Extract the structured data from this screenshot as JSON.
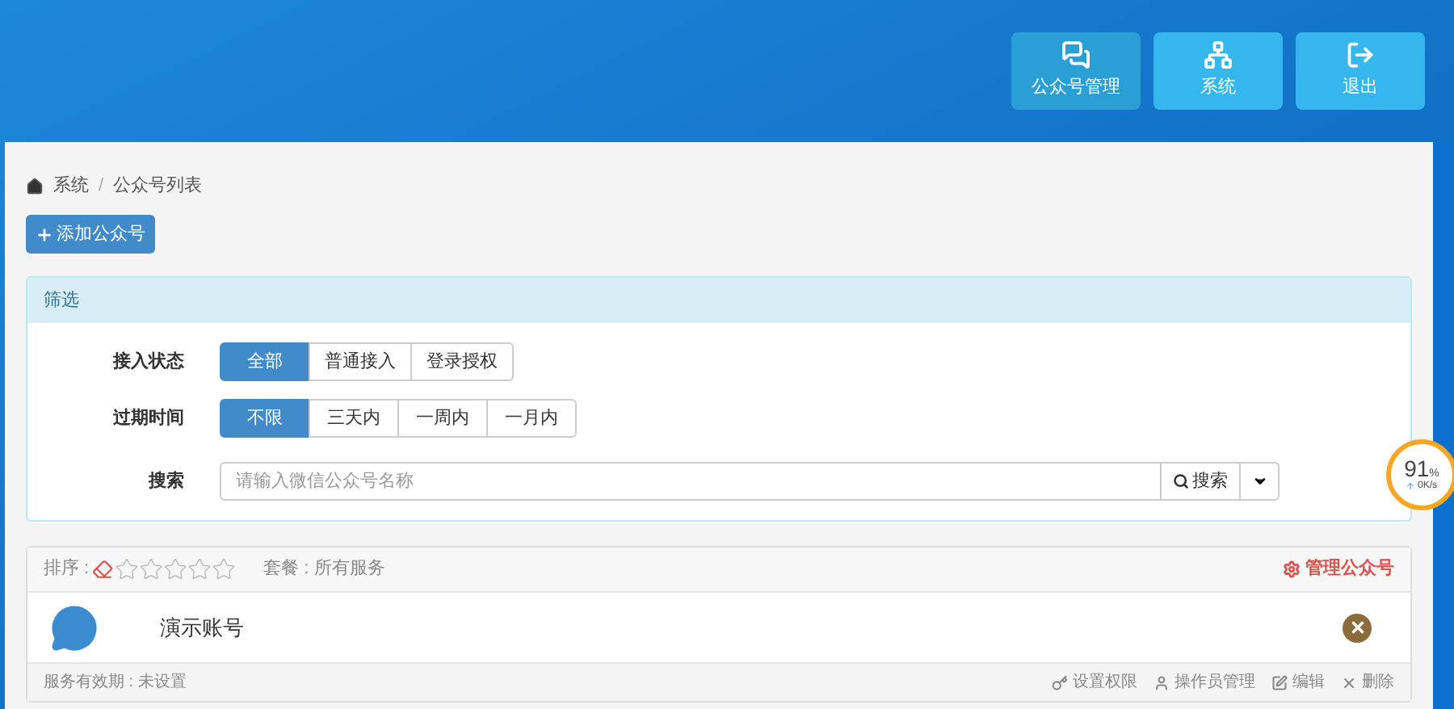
{
  "nav": [
    {
      "label": "公众号管理",
      "selected": true
    },
    {
      "label": "系统",
      "selected": false
    },
    {
      "label": "退出",
      "selected": false
    }
  ],
  "breadcrumb": {
    "items": [
      "系统",
      "公众号列表"
    ],
    "separator": "/"
  },
  "add_button": "添加公众号",
  "filter": {
    "title": "筛选",
    "groups": [
      {
        "label": "接入状态",
        "options": [
          {
            "label": "全部",
            "selected": true
          },
          {
            "label": "普通接入",
            "selected": false
          },
          {
            "label": "登录授权",
            "selected": false
          }
        ]
      },
      {
        "label": "过期时间",
        "options": [
          {
            "label": "不限",
            "selected": true
          },
          {
            "label": "三天内",
            "selected": false
          },
          {
            "label": "一周内",
            "selected": false
          },
          {
            "label": "一月内",
            "selected": false
          }
        ]
      }
    ],
    "search": {
      "label": "搜索",
      "placeholder": "请输入微信公众号名称",
      "button": "搜索"
    }
  },
  "account": {
    "sort_label": "排序 :",
    "stars": 0,
    "package": "套餐 : 所有服务",
    "manage": "管理公众号",
    "name": "演示账号",
    "validity": "服务有效期 : 未设置",
    "actions": [
      {
        "label": "设置权限"
      },
      {
        "label": "操作员管理"
      },
      {
        "label": "编辑"
      },
      {
        "label": "删除"
      }
    ]
  },
  "speed": {
    "percent": "91",
    "unit": "%",
    "rate": "0K/s"
  }
}
